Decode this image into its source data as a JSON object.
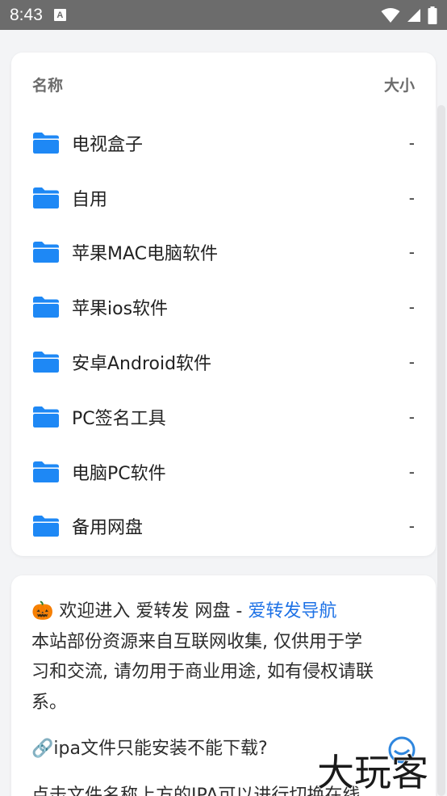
{
  "status_bar": {
    "time": "8:43",
    "notification_glyph": "A"
  },
  "file_list": {
    "header_name": "名称",
    "header_size": "大小",
    "rows": [
      {
        "name": "电视盒子",
        "size": "-"
      },
      {
        "name": "自用",
        "size": "-"
      },
      {
        "name": "苹果MAC电脑软件",
        "size": "-"
      },
      {
        "name": "苹果ios软件",
        "size": "-"
      },
      {
        "name": "安卓Android软件",
        "size": "-"
      },
      {
        "name": "PC签名工具",
        "size": "-"
      },
      {
        "name": "电脑PC软件",
        "size": "-"
      },
      {
        "name": "备用网盘",
        "size": "-"
      }
    ]
  },
  "notice": {
    "welcome_emoji": "🎃",
    "welcome_text": " 欢迎进入 爱转发 网盘 - ",
    "welcome_link": "爱转发导航",
    "line2": "本站部份资源来自互联网收集, 仅供用于学",
    "line3": "习和交流, 请勿用于商业用途, 如有侵权请联",
    "line4": "系。",
    "ipa_note": "🔗ipa文件只能安装不能下载?",
    "line6": "点击文件名称上方的IPA可以进行切换在线"
  },
  "watermark": {
    "text": "大玩客"
  },
  "colors": {
    "status_bar": "#6c6c6c",
    "background": "#f3f4f6",
    "folder": "#1e88f5",
    "link": "#1e72e6"
  },
  "icons": [
    "signal-a-icon",
    "wifi-icon",
    "cellular-icon",
    "battery-icon",
    "folder-icon",
    "watermark-logo"
  ]
}
